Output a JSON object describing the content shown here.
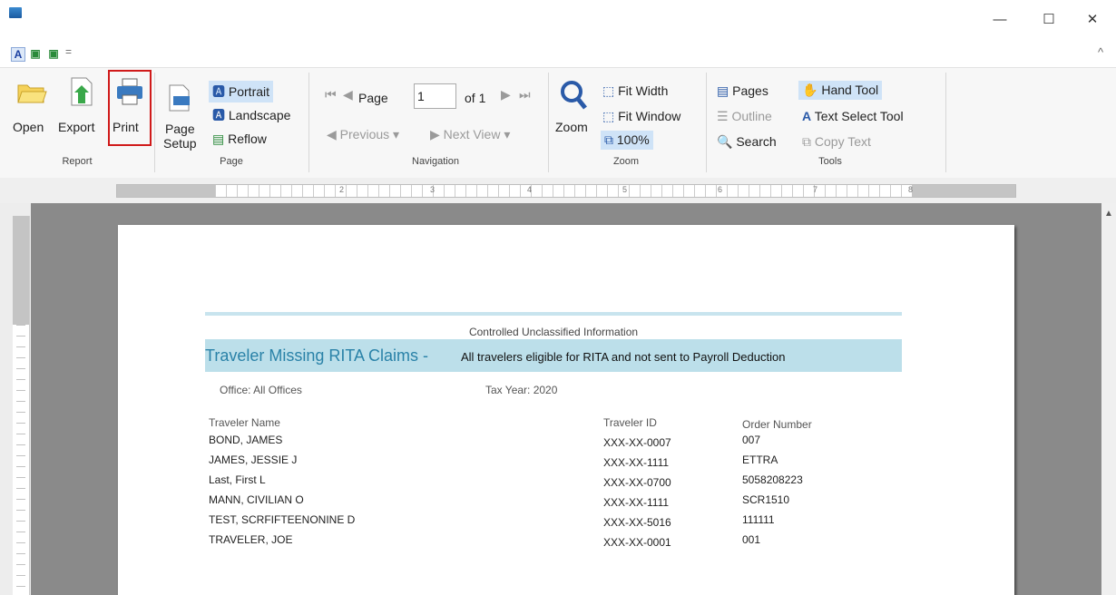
{
  "qat": {
    "collapse_caret": "^"
  },
  "window": {
    "minimize": "—",
    "maximize": "☐",
    "close": "✕"
  },
  "ribbon": {
    "report": {
      "group": "Report",
      "open": "Open",
      "export": "Export",
      "print": "Print"
    },
    "page": {
      "group": "Page",
      "setup_1": "Page",
      "setup_2": "Setup",
      "portrait": "Portrait",
      "landscape": "Landscape",
      "reflow": "Reflow"
    },
    "navigation": {
      "group": "Navigation",
      "page_label": "Page",
      "page_value": "1",
      "of": "of 1",
      "previous": "Previous",
      "next_view": "Next View"
    },
    "zoom": {
      "group": "Zoom",
      "zoom": "Zoom",
      "fit_width": "Fit Width",
      "fit_window": "Fit Window",
      "pct": "100%"
    },
    "tools": {
      "group": "Tools",
      "pages": "Pages",
      "outline": "Outline",
      "search": "Search",
      "hand": "Hand Tool",
      "text_select": "Text Select Tool",
      "copy_text": "Copy Text"
    }
  },
  "ruler": {
    "marks": [
      "2",
      "3",
      "4",
      "5",
      "6",
      "7",
      "8"
    ]
  },
  "report": {
    "classification": "Controlled Unclassified Information",
    "title": "Traveler Missing RITA Claims -",
    "subtitle": "All travelers eligible for RITA and not sent to Payroll Deduction",
    "office": "Office: All Offices",
    "tax_year": "Tax Year: 2020",
    "columns": [
      "Traveler Name",
      "Traveler ID",
      "Order Number"
    ],
    "rows": [
      [
        "BOND, JAMES",
        "XXX-XX-0007",
        "007"
      ],
      [
        "JAMES, JESSIE J",
        "XXX-XX-1111",
        "ETTRA"
      ],
      [
        "Last, First L",
        "XXX-XX-0700",
        "5058208223"
      ],
      [
        "MANN, CIVILIAN O",
        "XXX-XX-1111",
        "SCR1510"
      ],
      [
        "TEST, SCRFIFTEENONINE D",
        "XXX-XX-5016",
        "111111"
      ],
      [
        "TRAVELER, JOE",
        "XXX-XX-0001",
        "001"
      ]
    ]
  }
}
